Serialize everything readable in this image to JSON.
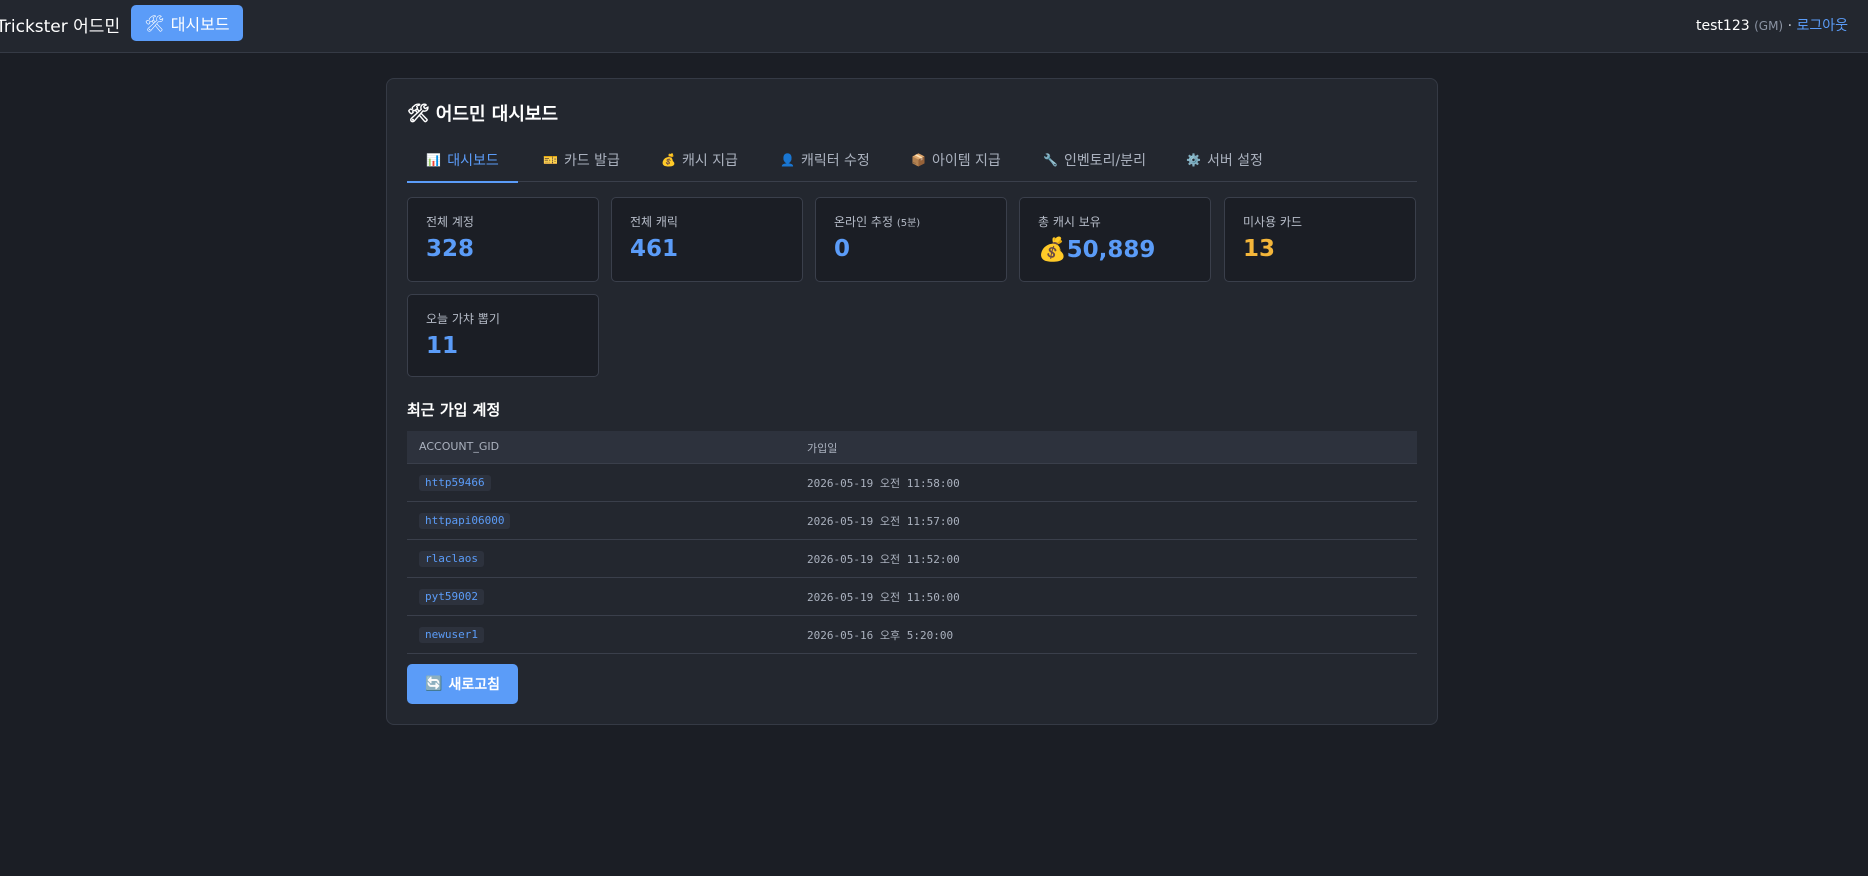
{
  "topbar": {
    "brand": "Trickster 어드민",
    "nav_icon": "🛠",
    "nav_label": "대시보드",
    "username": "test123",
    "role": "(GM)",
    "separator": "·",
    "logout": "로그아웃"
  },
  "card": {
    "title_icon": "🛠",
    "title": "어드민 대시보드"
  },
  "tabs": [
    {
      "icon": "📊",
      "label": "대시보드",
      "active": true
    },
    {
      "icon": "🎫",
      "label": "카드 발급"
    },
    {
      "icon": "💰",
      "label": "캐시 지급"
    },
    {
      "icon": "👤",
      "label": "캐릭터 수정"
    },
    {
      "icon": "📦",
      "label": "아이템 지급"
    },
    {
      "icon": "🔧",
      "label": "인벤토리/분리"
    },
    {
      "icon": "⚙️",
      "label": "서버 설정"
    }
  ],
  "stats": [
    {
      "label": "전체 계정",
      "value": "328"
    },
    {
      "label": "전체 캐릭",
      "value": "461"
    },
    {
      "label": "온라인 추정",
      "label_suffix": "(5분)",
      "value": "0"
    },
    {
      "label": "총 캐시 보유",
      "value_icon": "💰",
      "value": "50,889"
    },
    {
      "label": "미사용 카드",
      "value": "13",
      "color": "#f4b63a"
    },
    {
      "label": "오늘 가챠 뽑기",
      "value": "11"
    }
  ],
  "recent": {
    "title": "최근 가입 계정",
    "columns": [
      "ACCOUNT_GID",
      "가입일"
    ],
    "rows": [
      {
        "gid": "http59466",
        "date": "2026-05-19 오전 11:58:00"
      },
      {
        "gid": "httpapi06000",
        "date": "2026-05-19 오전 11:57:00"
      },
      {
        "gid": "rlaclaos",
        "date": "2026-05-19 오전 11:52:00"
      },
      {
        "gid": "pyt59002",
        "date": "2026-05-19 오전 11:50:00"
      },
      {
        "gid": "newuser1",
        "date": "2026-05-16 오후 5:20:00"
      }
    ]
  },
  "refresh": {
    "icon": "🔄",
    "label": "새로고침"
  },
  "colors": {
    "accent": "#5b9cf8",
    "gold": "#f4b63a",
    "background": "#1b1e25",
    "panel": "#23272f"
  }
}
